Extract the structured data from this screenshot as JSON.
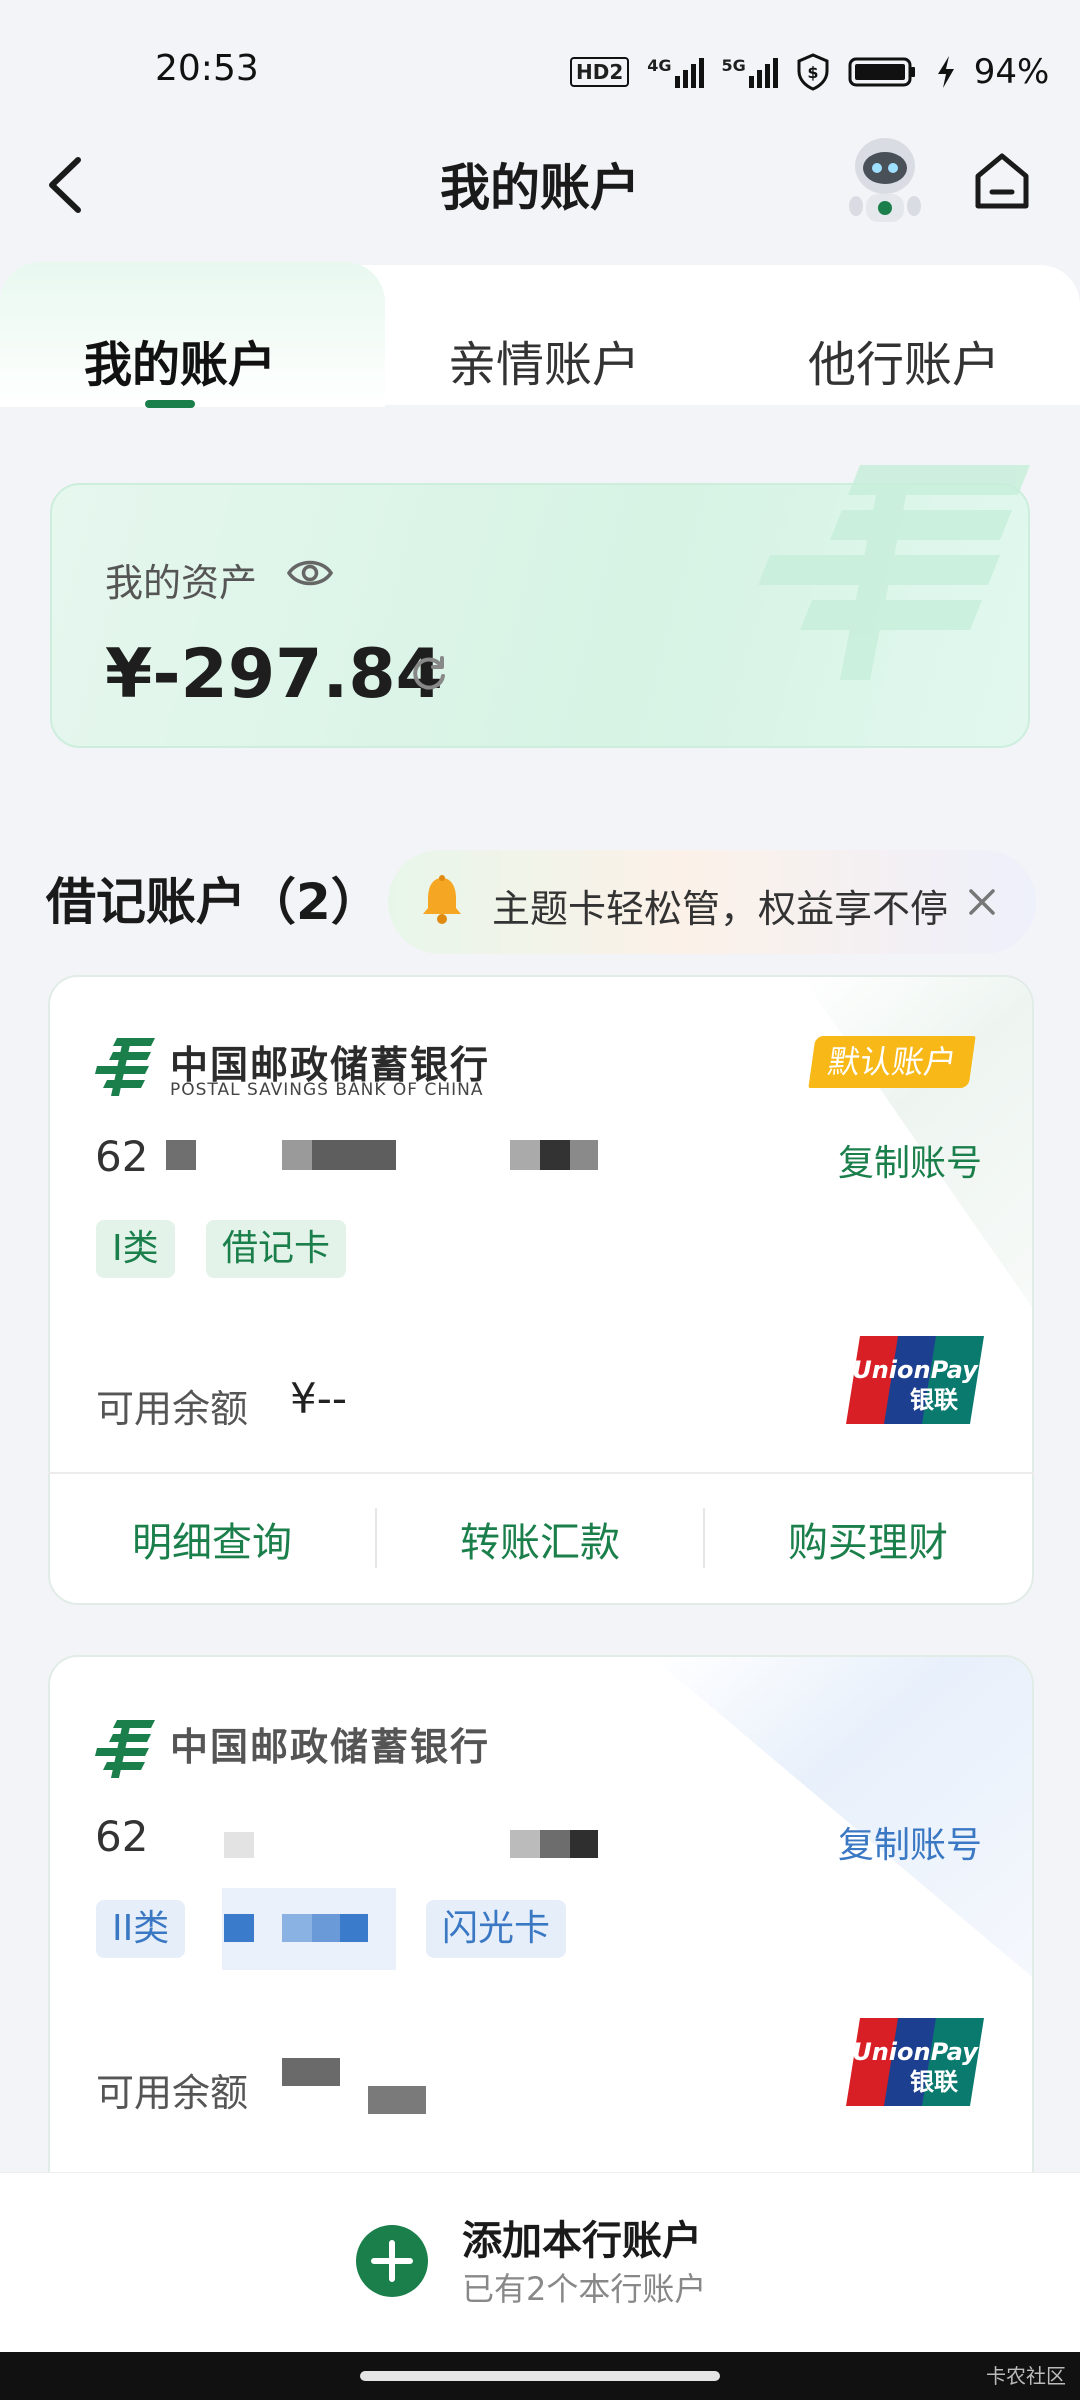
{
  "status_bar": {
    "time": "20:53",
    "hd": "HD2",
    "net1": "4G",
    "net2": "5G",
    "battery": "94%"
  },
  "header": {
    "title": "我的账户"
  },
  "tabs": [
    {
      "label": "我的账户",
      "active": true
    },
    {
      "label": "亲情账户",
      "active": false
    },
    {
      "label": "他行账户",
      "active": false
    }
  ],
  "assets": {
    "label": "我的资产",
    "value": "¥-297.84"
  },
  "section": {
    "title": "借记账户（2）"
  },
  "promo": {
    "text": "主题卡轻松管，权益享不停"
  },
  "bank": {
    "name_cn": "中国邮政储蓄银行",
    "name_en": "POSTAL SAVINGS BANK OF CHINA"
  },
  "accounts": [
    {
      "default_label": "默认账户",
      "number_prefix": "62",
      "copy_label": "复制账号",
      "tags": [
        "I类",
        "借记卡"
      ],
      "available_label": "可用余额",
      "available_value": "¥--"
    },
    {
      "number_prefix": "62",
      "copy_label": "复制账号",
      "tags": [
        "II类",
        "闪光卡"
      ],
      "available_label": "可用余额"
    }
  ],
  "actions": [
    {
      "label": "明细查询"
    },
    {
      "label": "转账汇款"
    },
    {
      "label": "购买理财"
    }
  ],
  "unionpay": {
    "en": "UnionPay",
    "cn": "银联"
  },
  "add_account": {
    "title": "添加本行账户",
    "subtitle": "已有2个本行账户"
  },
  "watermark": "卡农社区",
  "colors": {
    "primary": "#1b7f4b",
    "badge": "#f7b818",
    "blue": "#3a78c4"
  }
}
